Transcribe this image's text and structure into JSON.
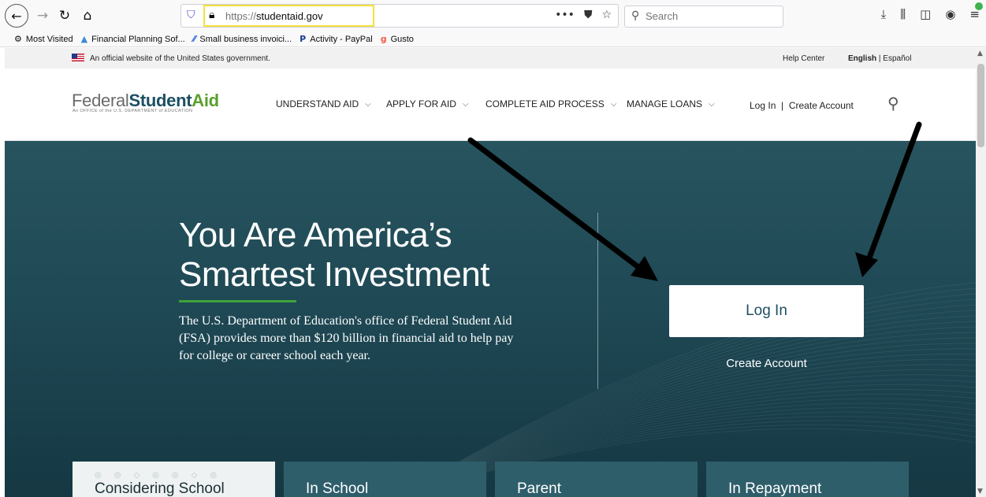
{
  "browser": {
    "url_protocol": "https://",
    "url_host": "studentaid.gov",
    "search_placeholder": "Search",
    "bookmarks": [
      {
        "label": "Most Visited",
        "icon": "gear-icon"
      },
      {
        "label": "Financial Planning Sof...",
        "icon": "financial-planning-icon"
      },
      {
        "label": "Small business invoici...",
        "icon": "wave-icon"
      },
      {
        "label": "Activity - PayPal",
        "icon": "paypal-icon"
      },
      {
        "label": "Gusto",
        "icon": "gusto-icon"
      }
    ]
  },
  "gov_banner": {
    "text": "An official website of the United States government.",
    "help_center": "Help Center",
    "lang_english": "English",
    "lang_sep": " | ",
    "lang_spanish": "Español"
  },
  "header": {
    "logo_federal": "Federal",
    "logo_student": "Student",
    "logo_aid": "Aid",
    "logo_sub": "An OFFICE of the U.S. DEPARTMENT of EDUCATION",
    "nav": [
      {
        "label": "UNDERSTAND AID"
      },
      {
        "label": "APPLY FOR AID"
      },
      {
        "label": "COMPLETE AID PROCESS"
      },
      {
        "label": "MANAGE LOANS"
      }
    ],
    "login": "Log In",
    "sep": "|",
    "create_account": "Create Account"
  },
  "hero": {
    "title_line1": "You Are America’s",
    "title_line2": "Smartest Investment",
    "text": "The U.S. Department of Education's office of Federal Student Aid (FSA) provides more than $120 billion in financial aid to help pay for college or career school each year.",
    "login_button": "Log In",
    "create_account": "Create Account"
  },
  "cards": [
    {
      "label": "Considering School"
    },
    {
      "label": "In School"
    },
    {
      "label": "Parent"
    },
    {
      "label": "In Repayment"
    }
  ],
  "colors": {
    "hero_dark": "#1f4955",
    "brand_teal": "#1d4f63",
    "brand_green": "#5aa02c",
    "url_highlight": "#f5e13a"
  }
}
